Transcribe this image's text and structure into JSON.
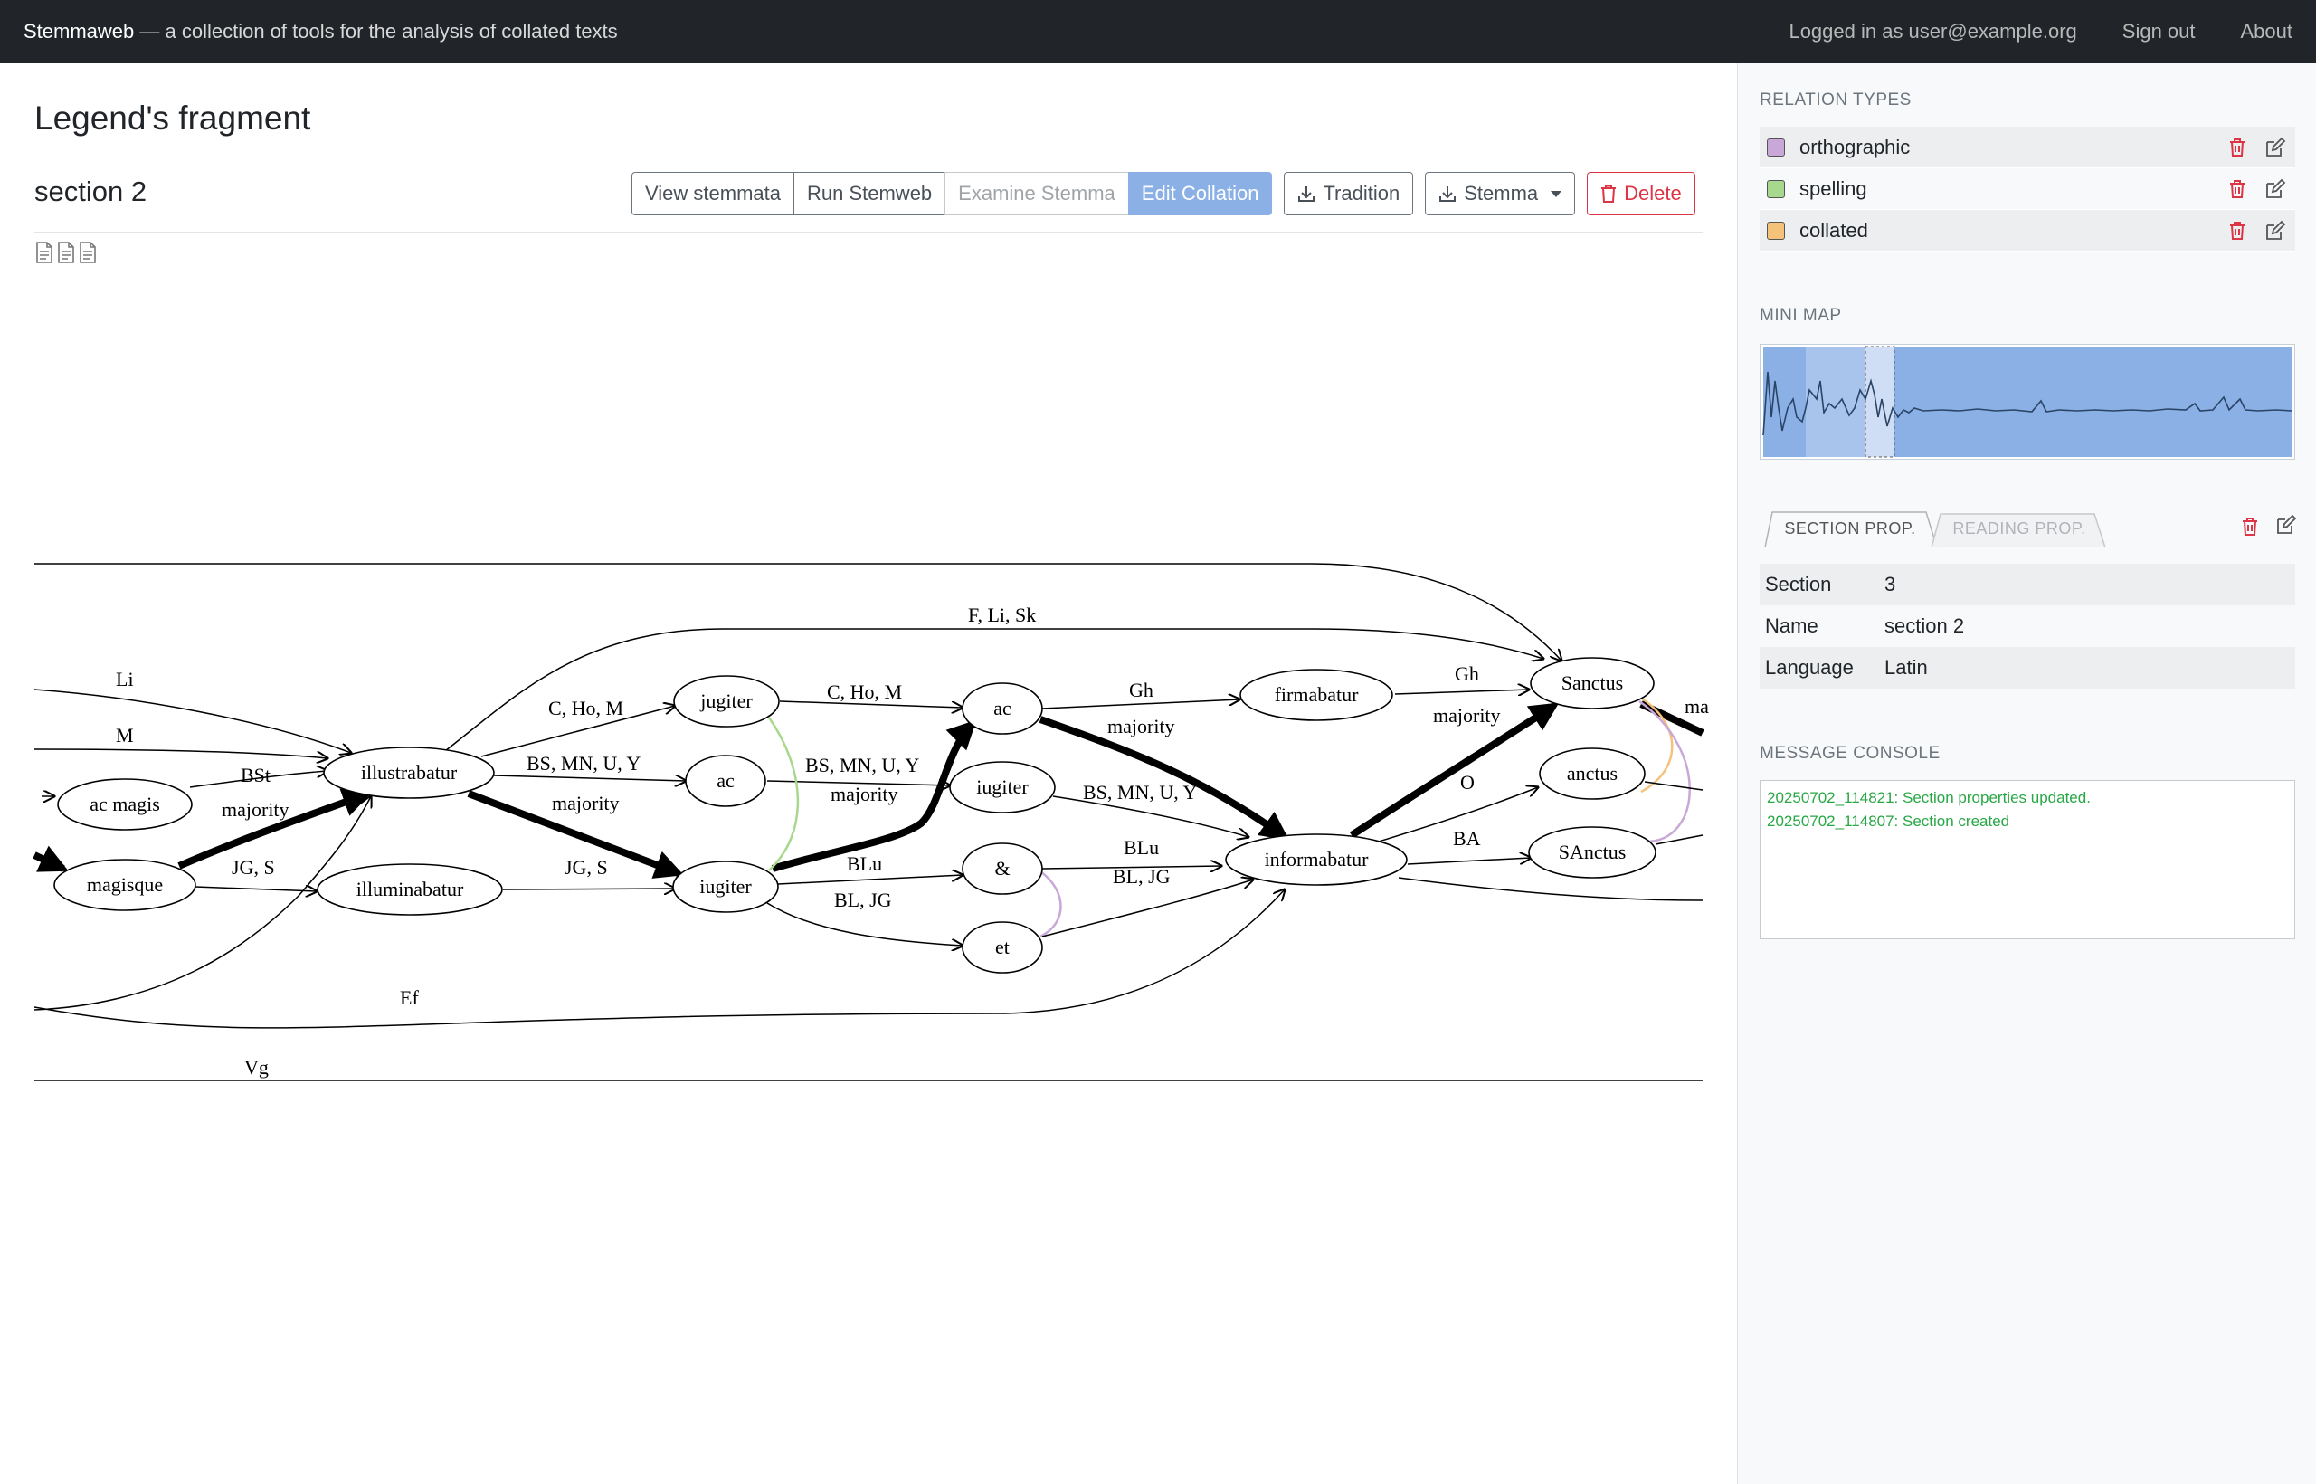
{
  "navbar": {
    "brand": "Stemmaweb",
    "tagline": " — a collection of tools for the analysis of collated texts",
    "logged_in": "Logged in as user@example.org",
    "sign_out": "Sign out",
    "about": "About"
  },
  "page": {
    "title": "Legend's fragment",
    "section": "section 2"
  },
  "toolbar": {
    "view_stemmata": "View stemmata",
    "run_stemweb": "Run Stemweb",
    "examine_stemma": "Examine Stemma",
    "edit_collation": "Edit Collation",
    "tradition": "Tradition",
    "stemma": "Stemma",
    "delete": "Delete"
  },
  "graph": {
    "nodes": {
      "ac_magis": "ac magis",
      "magisque": "magisque",
      "illustrabatur": "illustrabatur",
      "illuminabatur": "illuminabatur",
      "jugiter": "jugiter",
      "ac1": "ac",
      "iugiter1": "iugiter",
      "ac2": "ac",
      "iugiter2": "iugiter",
      "amp": "&",
      "et": "et",
      "firmabatur": "firmabatur",
      "informabatur": "informabatur",
      "sanctus": "Sanctus",
      "anctus": "anctus",
      "sanctus2": "SAnctus"
    },
    "labels": {
      "li": "Li",
      "m": "M",
      "bst": "BSt",
      "majority": "majority",
      "jgs": "JG, S",
      "fli": "F, Li, Sk",
      "chom": "C, Ho, M",
      "bsmnuy": "BS, MN, U, Y",
      "blu": "BLu",
      "bljg": "BL, JG",
      "gh": "Gh",
      "o": "O",
      "ba": "BA",
      "ef": "Ef",
      "vg": "Vg",
      "ma": "ma"
    }
  },
  "sidebar": {
    "relation_types_title": "RELATION TYPES",
    "relations": [
      {
        "name": "orthographic",
        "color": "#c9a8d8"
      },
      {
        "name": "spelling",
        "color": "#a8d88e"
      },
      {
        "name": "collated",
        "color": "#f5c27a"
      }
    ],
    "minimap_title": "MINI MAP",
    "tab_section": "SECTION PROP.",
    "tab_reading": "READING PROP.",
    "props": [
      {
        "key": "Section",
        "value": "3"
      },
      {
        "key": "Name",
        "value": "section 2"
      },
      {
        "key": "Language",
        "value": "Latin"
      }
    ],
    "console_title": "MESSAGE CONSOLE",
    "console": [
      "20250702_114821: Section properties updated.",
      "20250702_114807: Section created"
    ]
  }
}
